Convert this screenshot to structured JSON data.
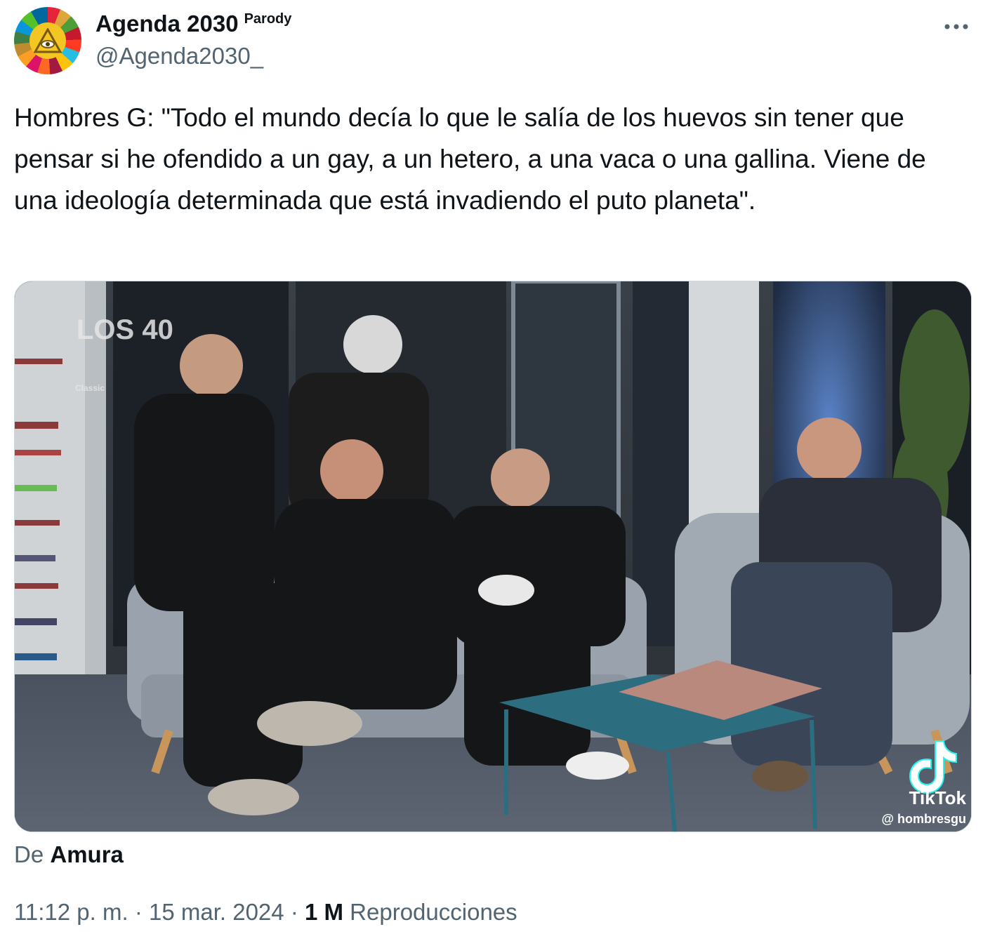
{
  "author": {
    "name": "Agenda 2030",
    "badge": "Parody",
    "handle": "@Agenda2030_"
  },
  "tweet": {
    "text": "Hombres G: \"Todo el mundo decía lo que le salía de los huevos sin tener que pensar si he ofendido a un gay, a un hetero, a una vaca o una gallina. Viene de una ideología determinada que está invadiendo el puto planeta\"."
  },
  "media": {
    "watermark_logo": "LOS 40",
    "watermark_sub": "Classic",
    "tiktok_label": "TikTok",
    "tiktok_handle": "@ hombresgu"
  },
  "source": {
    "prefix": "De",
    "name": "Amura"
  },
  "meta": {
    "time": "11:12 p. m.",
    "sep1": "·",
    "date": "15 mar. 2024",
    "sep2": "·",
    "views_count": "1 M",
    "views_label": "Reproducciones"
  },
  "icons": {
    "more": "more-icon",
    "avatar": "eye-triangle-icon",
    "tiktok": "tiktok-icon"
  },
  "colors": {
    "text": "#0f1419",
    "secondary": "#536471",
    "border": "#cfd9de"
  }
}
